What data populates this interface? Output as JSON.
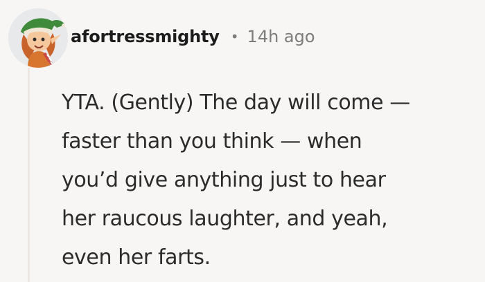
{
  "comment": {
    "author": "afortressmighty",
    "separator": "•",
    "timestamp": "14h ago",
    "body_lines": [
      "YTA. (Gently) The day will come —",
      "faster than you think — when",
      "you’d give anything just to hear",
      "her raucous laughter, and yeah,",
      "even her farts."
    ]
  },
  "colors": {
    "background": "#f7f6f4",
    "thread_line": "#ece7e2",
    "author_text": "#1c1c1c",
    "meta_text": "#7c7c7c",
    "body_text": "#2b2b2b"
  },
  "icons": {
    "avatar": "elf-character-avatar"
  }
}
